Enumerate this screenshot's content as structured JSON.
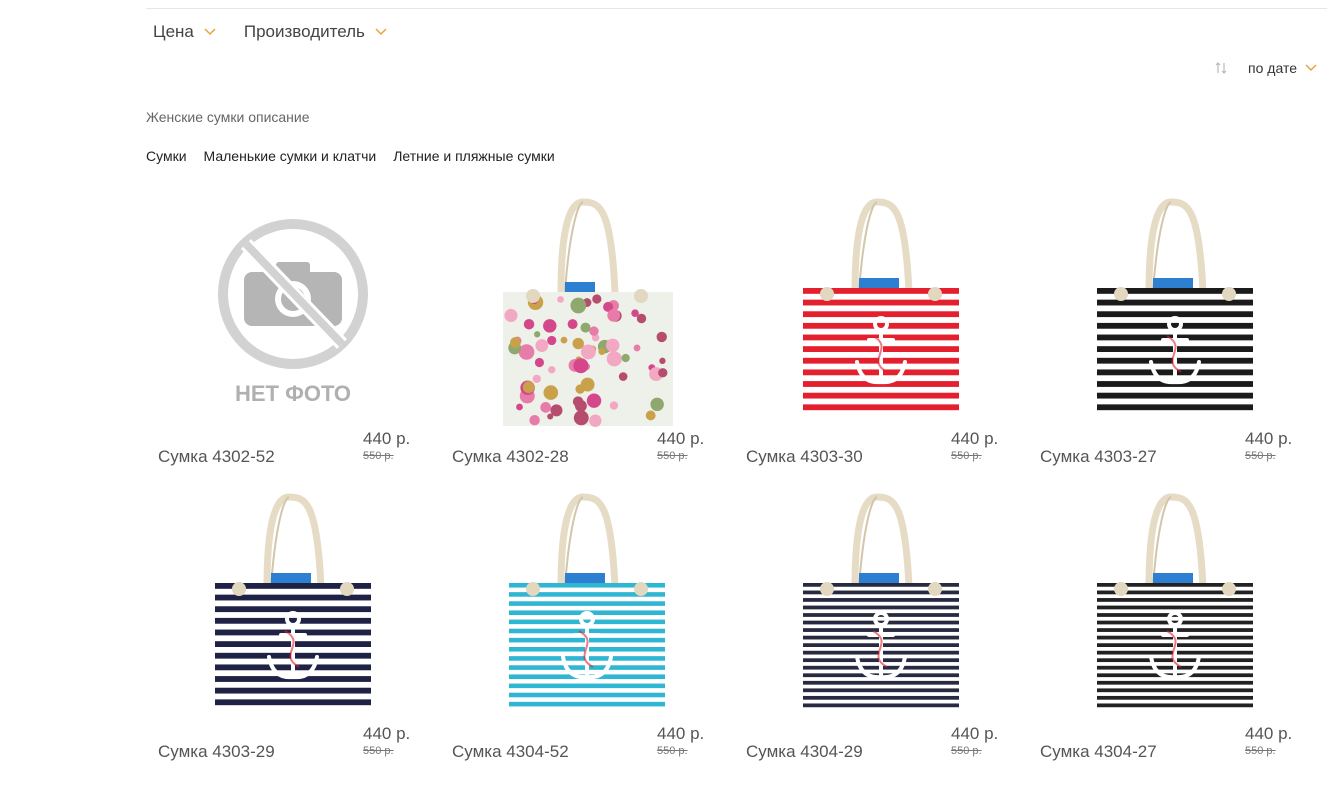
{
  "filters": [
    {
      "label": "Цена"
    },
    {
      "label": "Производитель"
    }
  ],
  "sort": {
    "label": "по дате"
  },
  "description": "Женские сумки описание",
  "subcategories": [
    "Сумки",
    "Маленькие сумки и клатчи",
    "Летние и пляжные сумки"
  ],
  "no_photo_text": "НЕТ ФОТО",
  "accent_color": "#e8a33d",
  "products": [
    {
      "name": "Сумка 4302-52",
      "price": "440 р.",
      "old_price": "550 р.",
      "image": "no-photo"
    },
    {
      "name": "Сумка 4302-28",
      "price": "440 р.",
      "old_price": "550 р.",
      "image": "floral-bag"
    },
    {
      "name": "Сумка 4303-30",
      "price": "440 р.",
      "old_price": "550 р.",
      "image": "red-striped-anchor-bag"
    },
    {
      "name": "Сумка 4303-27",
      "price": "440 р.",
      "old_price": "550 р.",
      "image": "black-striped-anchor-bag"
    },
    {
      "name": "Сумка 4303-29",
      "price": "440 р.",
      "old_price": "550 р.",
      "image": "navy-striped-anchor-bag"
    },
    {
      "name": "Сумка 4304-52",
      "price": "440 р.",
      "old_price": "550 р.",
      "image": "turquoise-striped-anchor-bag"
    },
    {
      "name": "Сумка 4304-29",
      "price": "440 р.",
      "old_price": "550 р.",
      "image": "navy-thin-striped-anchor-bag"
    },
    {
      "name": "Сумка 4304-27",
      "price": "440 р.",
      "old_price": "550 р.",
      "image": "black-thin-striped-anchor-bag"
    }
  ]
}
